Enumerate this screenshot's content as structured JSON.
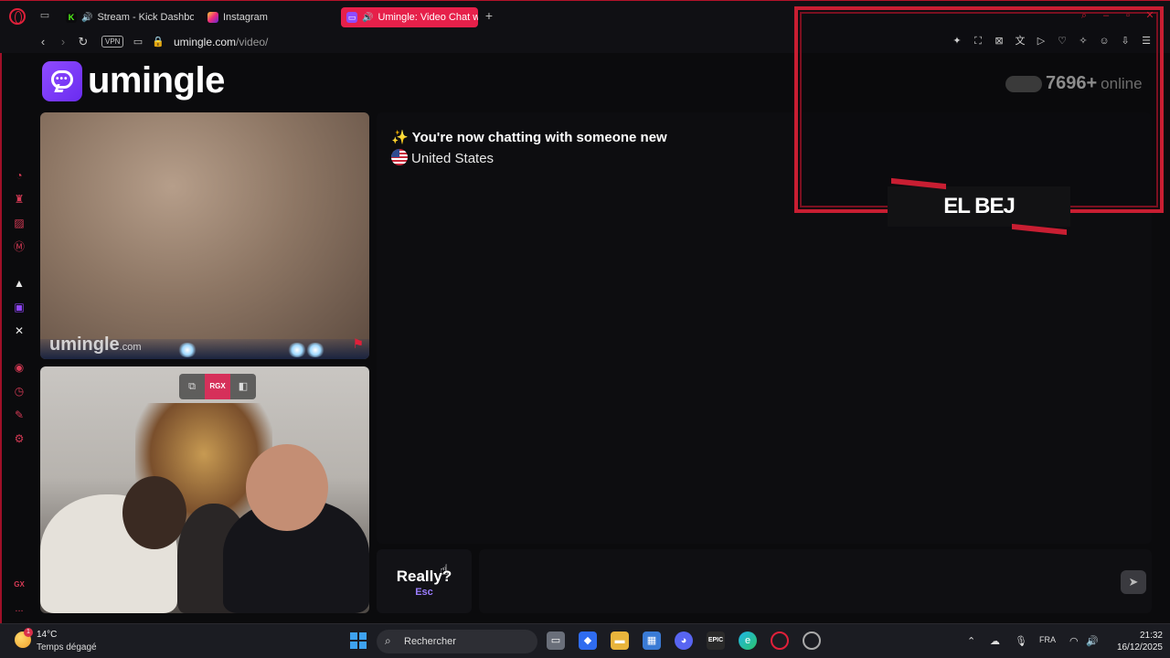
{
  "browser": {
    "tabs": [
      {
        "label": "Stream - Kick Dashbo",
        "active": false
      },
      {
        "label": "Instagram",
        "active": false
      },
      {
        "label": "Umingle: Video Chat w",
        "active": true
      }
    ],
    "vpn_label": "VPN",
    "url_domain": "umingle.com",
    "url_path": "/video/"
  },
  "site": {
    "logo_text": "umingle",
    "watermark_main": "umingle",
    "watermark_suffix": ".com",
    "video_controls": {
      "rgx_label": "RGX"
    }
  },
  "chat": {
    "status_line": "✨ You're now chatting with someone new",
    "country": "United States",
    "message_placeholder": ""
  },
  "skip_button": {
    "label": "Really?",
    "hint": "Esc"
  },
  "stream_overlay": {
    "online_count": "7696+",
    "online_label": "online",
    "streamer_name": "EL BEJ"
  },
  "sidebar": {
    "bottom_label": "GX",
    "more_label": "..."
  },
  "taskbar": {
    "weather_temp": "14°C",
    "weather_desc": "Temps dégagé",
    "weather_badge": "1",
    "search_placeholder": "Rechercher",
    "language": "FRA",
    "time": "21:32",
    "date": "16/12/2025"
  },
  "colors": {
    "accent": "#e6204a",
    "brand_purple": "#8f4bff",
    "overlay_red": "#c81e32"
  }
}
